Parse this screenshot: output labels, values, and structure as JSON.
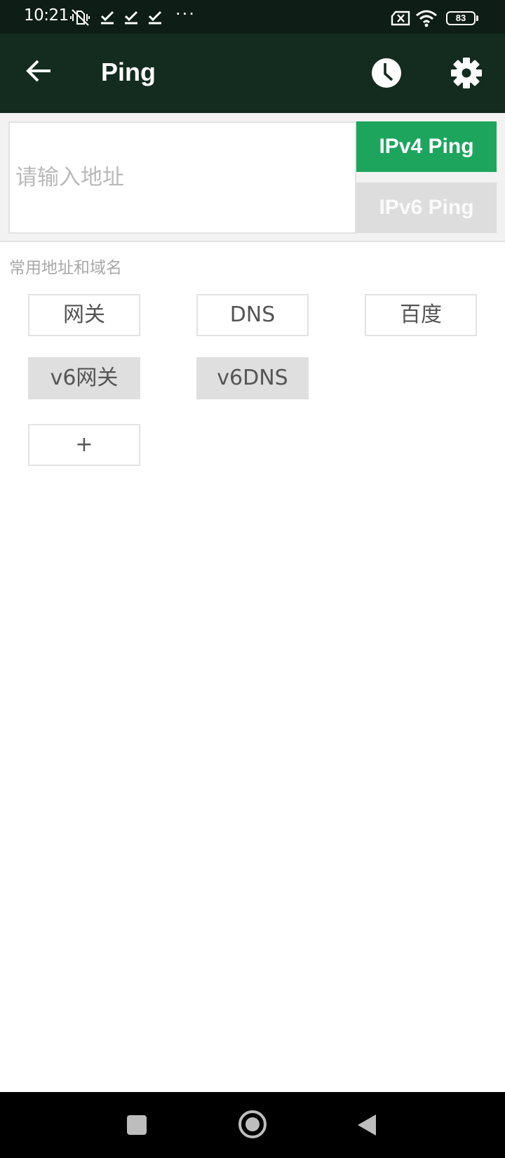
{
  "status_bar": {
    "time": "10:21",
    "dots": "···",
    "battery": "83"
  },
  "app_bar": {
    "title": "Ping"
  },
  "input_panel": {
    "placeholder": "请输入地址",
    "value": "",
    "ipv4_label": "IPv4 Ping",
    "ipv6_label": "IPv6 Ping"
  },
  "section": {
    "label": "常用地址和域名",
    "chips": [
      {
        "label": "网关",
        "enabled": true
      },
      {
        "label": "DNS",
        "enabled": true
      },
      {
        "label": "百度",
        "enabled": true
      },
      {
        "label": "v6网关",
        "enabled": false
      },
      {
        "label": "v6DNS",
        "enabled": false
      },
      {
        "label": "+",
        "enabled": true
      }
    ]
  },
  "colors": {
    "status_bar": "#0e1d15",
    "app_bar": "#142b20",
    "accent_green": "#1da55e",
    "disabled_gray": "#dddddd"
  },
  "icons": {
    "back": "arrow-left-icon",
    "history": "clock-icon",
    "settings": "gear-icon",
    "nav_recents": "square-icon",
    "nav_home": "circle-icon",
    "nav_back": "triangle-left-icon"
  }
}
